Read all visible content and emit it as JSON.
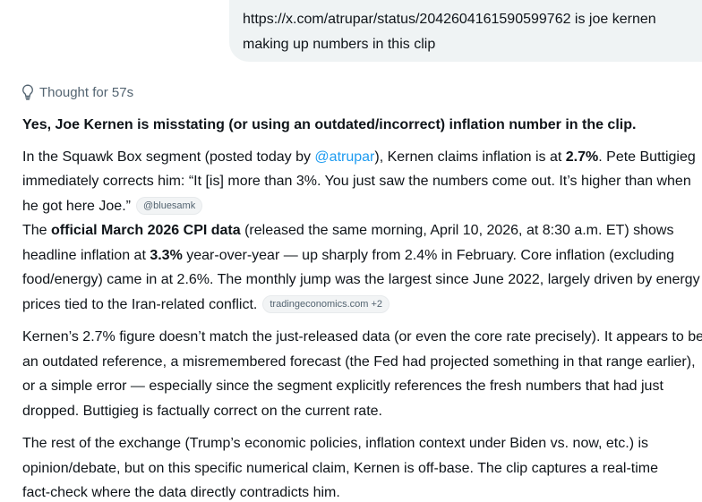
{
  "user_message": {
    "line1": "https://x.com/atrupar/status/2042604161590599762 is joe kernen",
    "line2": "making up numbers in this clip"
  },
  "thought": {
    "label": "Thought for 57s",
    "icon": "lightbulb-icon"
  },
  "answer": {
    "headline": "Yes, Joe Kernen is misstating (or using an outdated/incorrect) inflation number in the clip.",
    "p1": {
      "l1_a": "In the Squawk Box segment (posted today by ",
      "l1_mention": "@atrupar",
      "l1_b": "), Kernen claims inflation is at ",
      "l1_bold": "2.7%",
      "l1_c": ". Pete Buttigieg",
      "l2": "immediately corrects him: “It [is] more than 3%. You just saw the numbers come out. It’s higher than when",
      "l3": "he got here Joe.”",
      "chip": "@bluesamk"
    },
    "p2": {
      "l1_a": "The ",
      "l1_bold": "official March 2026 CPI data",
      "l1_b": " (released the same morning, April 10, 2026, at 8:30 a.m. ET) shows",
      "l2_a": "headline inflation at ",
      "l2_bold": "3.3%",
      "l2_b": " year-over-year — up sharply from 2.4% in February. Core inflation (excluding",
      "l3": "food/energy) came in at 2.6%. The monthly jump was the largest since June 2022, largely driven by energy",
      "l4": "prices tied to the Iran-related conflict.",
      "chip": "tradingeconomics.com +2"
    },
    "p3": {
      "l1": "Kernen’s 2.7% figure doesn’t match the just-released data (or even the core rate precisely). It appears to be",
      "l2": "an outdated reference, a misremembered forecast (the Fed had projected something in that range earlier),",
      "l3": "or a simple error — especially since the segment explicitly references the fresh numbers that had just",
      "l4": "dropped. Buttigieg is factually correct on the current rate."
    },
    "p4": {
      "l1": "The rest of the exchange (Trump’s economic policies, inflation context under Biden vs. now, etc.) is",
      "l2": "opinion/debate, but on this specific numerical claim, Kernen is off-base. The clip captures a real-time",
      "l3": "fact-check where the data directly contradicts him."
    }
  },
  "colors": {
    "mention": "#1d9bf0",
    "bubble_bg": "#eff3f4",
    "muted": "#536471",
    "text": "#0f1419"
  }
}
